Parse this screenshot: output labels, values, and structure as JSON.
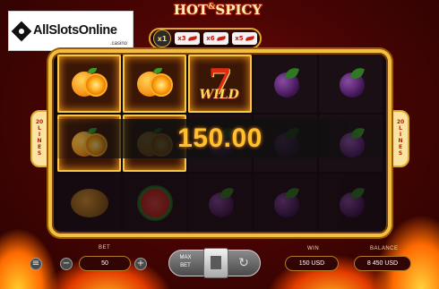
{
  "logo": {
    "brand": "AllSlotsOnline",
    "sub": ".casino"
  },
  "game": {
    "title_a": "HOT",
    "title_amp": "&",
    "title_b": "SPICY"
  },
  "multiplier": {
    "badge": "x1",
    "chilis": [
      "x3",
      "x6",
      "x5"
    ]
  },
  "lines": {
    "left": [
      "20",
      "L",
      "I",
      "N",
      "E",
      "S"
    ],
    "right": [
      "20",
      "L",
      "I",
      "N",
      "E",
      "S"
    ]
  },
  "reels": [
    [
      "orange",
      "orange",
      "wild",
      "plum",
      "plum"
    ],
    [
      "orange",
      "orange",
      "plum",
      "plum",
      "plum"
    ],
    [
      "lemon",
      "melon",
      "plum",
      "plum",
      "plum"
    ]
  ],
  "win_cells": [
    [
      0,
      0
    ],
    [
      0,
      1
    ],
    [
      0,
      2
    ],
    [
      1,
      0
    ],
    [
      1,
      1
    ]
  ],
  "win_amount": "150.00",
  "wild_word": "WILD",
  "controls": {
    "bet_label": "BET",
    "bet_value": "50",
    "minus": "−",
    "plus": "+",
    "menu": "≡",
    "max_bet_line1": "MAX",
    "max_bet_line2": "BET",
    "win_label": "WIN",
    "win_value": "150 USD",
    "balance_label": "BALANCE",
    "balance_value": "8 450 USD"
  }
}
